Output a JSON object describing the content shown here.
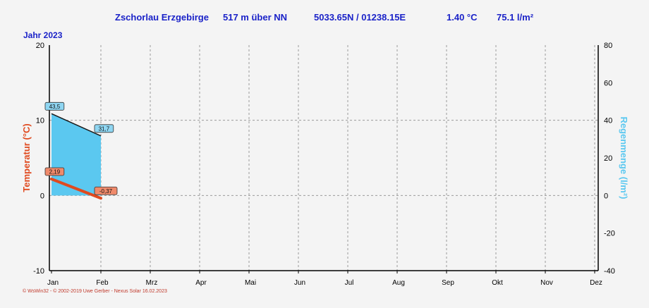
{
  "header": {
    "station": "Zschorlau Erzgebirge",
    "altitude": "517 m über NN",
    "coords": "5033.65N / 01238.15E",
    "temp": "1.40 °C",
    "rain": "75.1 l/m²"
  },
  "year_label": "Jahr  2023",
  "footer": "© WsWin32  -  © 2002-2019 Uwe Gerber - Nexus Solar  16.02.2023",
  "colors": {
    "header": "#1a22c8",
    "temperature": "#e04a1f",
    "rain_fill": "#5bc8f0",
    "rain_line": "#1a1a1a",
    "grid": "#9a9a9a",
    "background": "#f4f4f4"
  },
  "chart_data": {
    "type": "line",
    "x_ticks": [
      "Jan",
      "Feb",
      "Mrz",
      "Apr",
      "Mai",
      "Jun",
      "Jul",
      "Aug",
      "Sep",
      "Okt",
      "Nov",
      "Dez"
    ],
    "left_axis": {
      "label": "Temperatur  (°C)",
      "range": [
        -10,
        20
      ],
      "ticks": [
        "20",
        "10",
        "0",
        "-10"
      ]
    },
    "right_axis": {
      "label": "Regenmenge  (l/m²)",
      "range": [
        -40,
        80
      ],
      "ticks": [
        "80",
        "60",
        "40",
        "20",
        "0",
        "-20",
        "-40"
      ]
    },
    "grid": true,
    "series": [
      {
        "axis": "right",
        "style": "area",
        "x": [
          "Jan",
          "Feb"
        ],
        "values": [
          43.5,
          31.7
        ],
        "labels": [
          "43,5",
          "31,7"
        ]
      },
      {
        "axis": "left",
        "style": "line",
        "x": [
          "Jan",
          "Feb"
        ],
        "values": [
          2.19,
          -0.37
        ],
        "labels": [
          "2,19",
          "-0,37"
        ]
      }
    ]
  }
}
